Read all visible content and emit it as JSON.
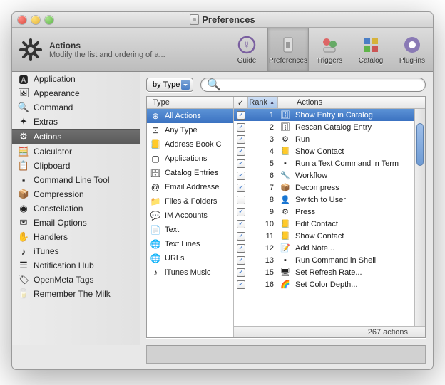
{
  "window": {
    "title": "Preferences"
  },
  "header": {
    "title": "Actions",
    "subtitle": "Modify the list and ordering of a..."
  },
  "toolbar": [
    {
      "id": "guide",
      "label": "Guide"
    },
    {
      "id": "preferences",
      "label": "Preferences",
      "selected": true
    },
    {
      "id": "triggers",
      "label": "Triggers"
    },
    {
      "id": "catalog",
      "label": "Catalog"
    },
    {
      "id": "plugins",
      "label": "Plug-ins"
    }
  ],
  "sidebar": {
    "items": [
      {
        "label": "Application",
        "icon": "app"
      },
      {
        "label": "Appearance",
        "icon": "appear"
      },
      {
        "label": "Command",
        "icon": "search"
      },
      {
        "label": "Extras",
        "icon": "extras"
      },
      {
        "label": "Actions",
        "icon": "gear",
        "selected": true
      },
      {
        "label": "Calculator",
        "icon": "calc"
      },
      {
        "label": "Clipboard",
        "icon": "clip"
      },
      {
        "label": "Command Line Tool",
        "icon": "term"
      },
      {
        "label": "Compression",
        "icon": "zip"
      },
      {
        "label": "Constellation",
        "icon": "disc"
      },
      {
        "label": "Email Options",
        "icon": "mail"
      },
      {
        "label": "Handlers",
        "icon": "hand"
      },
      {
        "label": "iTunes",
        "icon": "itunes"
      },
      {
        "label": "Notification Hub",
        "icon": "bell"
      },
      {
        "label": "OpenMeta Tags",
        "icon": "tag"
      },
      {
        "label": "Remember The Milk",
        "icon": "rtm"
      }
    ]
  },
  "filter": {
    "mode": "by Type",
    "search_placeholder": ""
  },
  "columns": {
    "type": "Type",
    "check": "✓",
    "rank": "Rank",
    "actions": "Actions"
  },
  "types": [
    {
      "label": "All Actions",
      "selected": true
    },
    {
      "label": "Any Type"
    },
    {
      "label": "Address Book C"
    },
    {
      "label": "Applications"
    },
    {
      "label": "Catalog Entries"
    },
    {
      "label": "Email Addresse"
    },
    {
      "label": "Files & Folders"
    },
    {
      "label": "IM Accounts"
    },
    {
      "label": "Text"
    },
    {
      "label": "Text Lines"
    },
    {
      "label": "URLs"
    },
    {
      "label": "iTunes Music"
    }
  ],
  "actions": [
    {
      "checked": true,
      "rank": 1,
      "label": "Show Entry in Catalog",
      "selected": true
    },
    {
      "checked": true,
      "rank": 2,
      "label": "Rescan Catalog Entry"
    },
    {
      "checked": true,
      "rank": 3,
      "label": "Run"
    },
    {
      "checked": true,
      "rank": 4,
      "label": "Show Contact"
    },
    {
      "checked": true,
      "rank": 5,
      "label": "Run a Text Command in Term"
    },
    {
      "checked": true,
      "rank": 6,
      "label": "Workflow"
    },
    {
      "checked": true,
      "rank": 7,
      "label": "Decompress"
    },
    {
      "checked": false,
      "rank": 8,
      "label": "Switch to User"
    },
    {
      "checked": true,
      "rank": 9,
      "label": "Press"
    },
    {
      "checked": true,
      "rank": 10,
      "label": "Edit Contact"
    },
    {
      "checked": true,
      "rank": 11,
      "label": "Show Contact"
    },
    {
      "checked": true,
      "rank": 12,
      "label": "Add Note..."
    },
    {
      "checked": true,
      "rank": 13,
      "label": "Run Command in Shell"
    },
    {
      "checked": true,
      "rank": 15,
      "label": "Set Refresh Rate..."
    },
    {
      "checked": true,
      "rank": 16,
      "label": "Set Color Depth..."
    }
  ],
  "status": {
    "count_text": "267 actions"
  },
  "icons": {
    "type_map": {
      "All Actions": "⊕",
      "Any Type": "⊡",
      "Address Book C": "📒",
      "Applications": "▢",
      "Catalog Entries": "🗄",
      "Email Addresse": "@",
      "Files & Folders": "📁",
      "IM Accounts": "💬",
      "Text": "📄",
      "Text Lines": "🌐",
      "URLs": "🌐",
      "iTunes Music": "♪"
    },
    "action_map": {
      "1": "🗄",
      "2": "🗄",
      "3": "⚙",
      "4": "📒",
      "5": "▪",
      "6": "🔧",
      "7": "📦",
      "8": "👤",
      "9": "⚙",
      "10": "📒",
      "11": "📒",
      "12": "📝",
      "13": "▪",
      "15": "🖥",
      "16": "🌈"
    },
    "sidebar_map": {
      "app": "🅰",
      "appear": "🖼",
      "search": "🔍",
      "extras": "✦",
      "gear": "⚙",
      "calc": "🧮",
      "clip": "📋",
      "term": "▪",
      "zip": "📦",
      "disc": "◉",
      "mail": "✉",
      "hand": "✋",
      "itunes": "♪",
      "bell": "☰",
      "tag": "🏷",
      "rtm": "🥛"
    }
  }
}
